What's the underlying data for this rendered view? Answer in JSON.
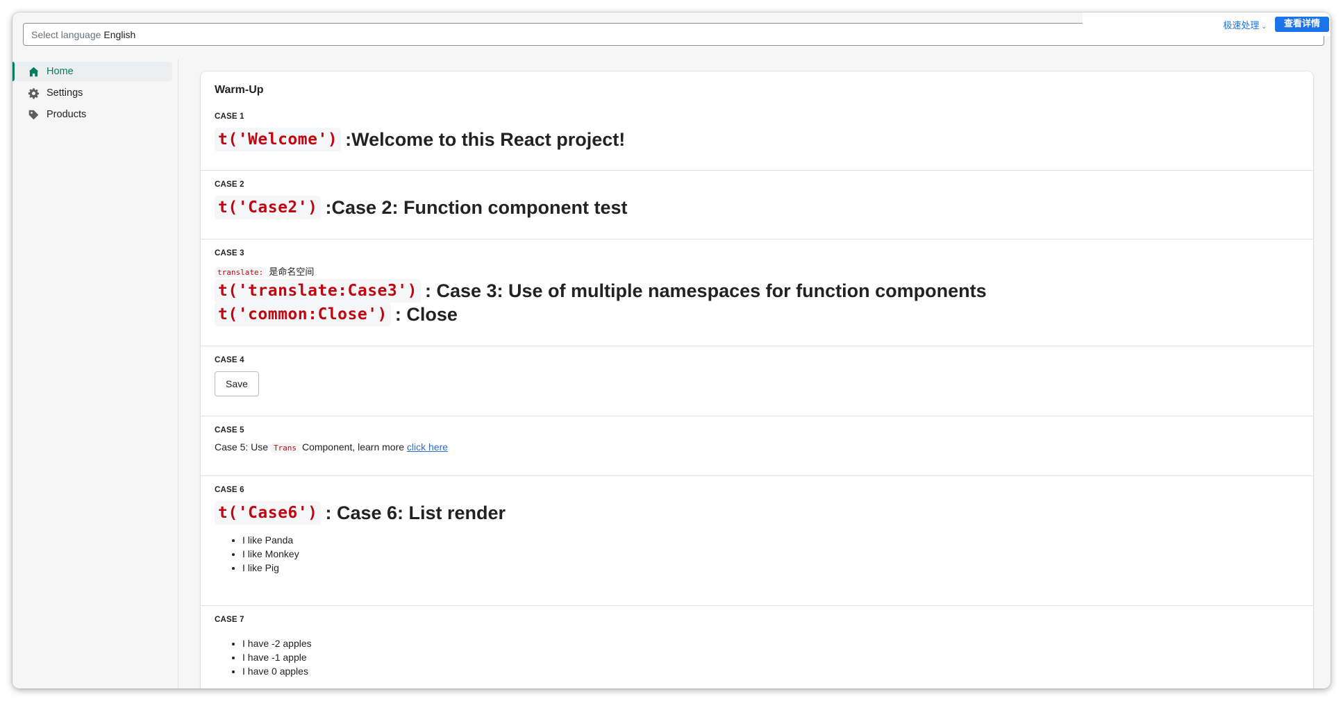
{
  "language_select": {
    "label": "Select language",
    "value": "English"
  },
  "floating_bar": {
    "speed_label": "极速处理",
    "detail_button": "查看详情"
  },
  "sidebar": {
    "items": [
      {
        "label": "Home",
        "icon": "home-icon",
        "active": true
      },
      {
        "label": "Settings",
        "icon": "gear-icon",
        "active": false
      },
      {
        "label": "Products",
        "icon": "tag-icon",
        "active": false
      }
    ]
  },
  "colors": {
    "accent": "#008060",
    "active_text": "#007f5f",
    "code_text": "#bf0711",
    "link": "#2c6ecb",
    "floating_blue": "#1a73e8"
  },
  "main": {
    "title": "Warm-Up",
    "case1": {
      "label": "CASE 1",
      "code": "t('Welcome')",
      "text": ":Welcome to this React project!"
    },
    "case2": {
      "label": "CASE 2",
      "code": "t('Case2')",
      "text": ":Case 2: Function component test"
    },
    "case3": {
      "label": "CASE 3",
      "ns_code": "translate:",
      "ns_text": "是命名空间",
      "line1_code": "t('translate:Case3')",
      "line1_text": ": Case 3: Use of multiple namespaces for function components",
      "line2_code": "t('common:Close')",
      "line2_text": ": Close"
    },
    "case4": {
      "label": "CASE 4",
      "button": "Save"
    },
    "case5": {
      "label": "CASE 5",
      "prefix": "Case 5: Use",
      "code": "Trans",
      "middle": "Component, learn more",
      "link": "click here"
    },
    "case6": {
      "label": "CASE 6",
      "code": "t('Case6')",
      "text": ": Case 6: List render",
      "items": [
        "I like Panda",
        "I like Monkey",
        "I like Pig"
      ]
    },
    "case7": {
      "label": "CASE 7",
      "items": [
        "I have -2 apples",
        "I have -1 apple",
        "I have 0 apples"
      ]
    }
  }
}
